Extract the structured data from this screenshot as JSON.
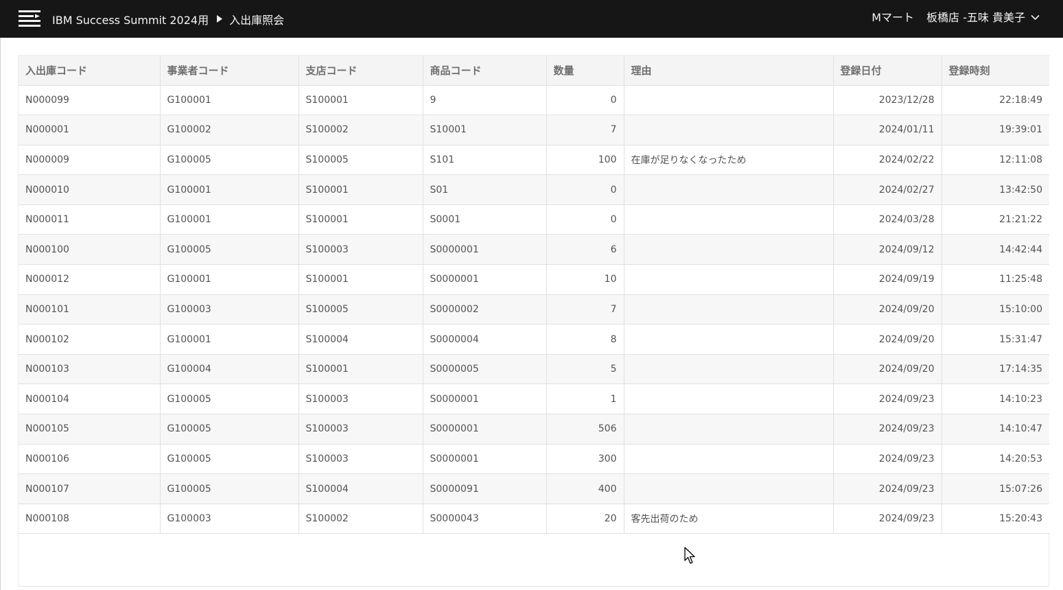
{
  "header": {
    "app_title": "IBM Success Summit 2024用",
    "current_page": "入出庫照会",
    "store": "Mマート",
    "user": "板橋店 -五味 貴美子"
  },
  "table": {
    "columns": [
      "入出庫コード",
      "事業者コード",
      "支店コード",
      "商品コード",
      "数量",
      "理由",
      "登録日付",
      "登録時刻"
    ],
    "rows": [
      [
        "N000099",
        "G100001",
        "S100001",
        "9",
        "0",
        "",
        "2023/12/28",
        "22:18:49"
      ],
      [
        "N000001",
        "G100002",
        "S100002",
        "S10001",
        "7",
        "",
        "2024/01/11",
        "19:39:01"
      ],
      [
        "N000009",
        "G100005",
        "S100005",
        "S101",
        "100",
        "在庫が足りなくなったため",
        "2024/02/22",
        "12:11:08"
      ],
      [
        "N000010",
        "G100001",
        "S100001",
        "S01",
        "0",
        "",
        "2024/02/27",
        "13:42:50"
      ],
      [
        "N000011",
        "G100001",
        "S100001",
        "S0001",
        "0",
        "",
        "2024/03/28",
        "21:21:22"
      ],
      [
        "N000100",
        "G100005",
        "S100003",
        "S0000001",
        "6",
        "",
        "2024/09/12",
        "14:42:44"
      ],
      [
        "N000012",
        "G100001",
        "S100001",
        "S0000001",
        "10",
        "",
        "2024/09/19",
        "11:25:48"
      ],
      [
        "N000101",
        "G100003",
        "S100005",
        "S0000002",
        "7",
        "",
        "2024/09/20",
        "15:10:00"
      ],
      [
        "N000102",
        "G100001",
        "S100004",
        "S0000004",
        "8",
        "",
        "2024/09/20",
        "15:31:47"
      ],
      [
        "N000103",
        "G100004",
        "S100001",
        "S0000005",
        "5",
        "",
        "2024/09/20",
        "17:14:35"
      ],
      [
        "N000104",
        "G100005",
        "S100003",
        "S0000001",
        "1",
        "",
        "2024/09/23",
        "14:10:23"
      ],
      [
        "N000105",
        "G100005",
        "S100003",
        "S0000001",
        "506",
        "",
        "2024/09/23",
        "14:10:47"
      ],
      [
        "N000106",
        "G100005",
        "S100003",
        "S0000001",
        "300",
        "",
        "2024/09/23",
        "14:20:53"
      ],
      [
        "N000107",
        "G100005",
        "S100004",
        "S0000091",
        "400",
        "",
        "2024/09/23",
        "15:07:26"
      ],
      [
        "N000108",
        "G100003",
        "S100002",
        "S0000043",
        "20",
        "客先出荷のため",
        "2024/09/23",
        "15:20:43"
      ]
    ]
  },
  "icons": {
    "menu": "hamburger-menu-icon",
    "breadcrumb_separator": "caret-right-icon",
    "user_dropdown": "chevron-down-icon",
    "cursor": "mouse-pointer-icon"
  },
  "colors": {
    "header_bg": "#161616",
    "header_text": "#f4f4f4",
    "table_header_bg": "#f4f4f4",
    "zebra_row_bg": "#f7f7f7"
  }
}
